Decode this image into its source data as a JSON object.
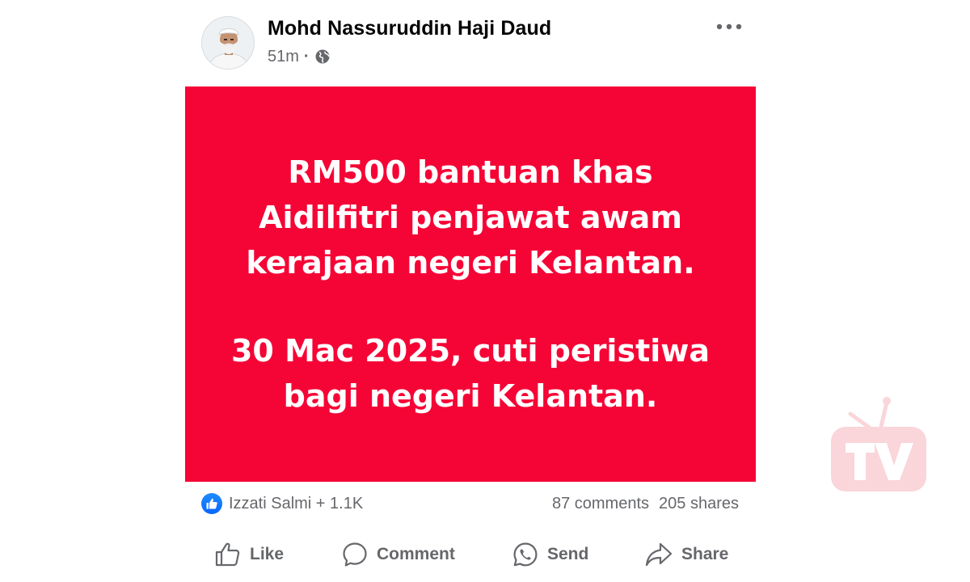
{
  "post": {
    "author": "Mohd Nassuruddin Haji Daud",
    "timestamp": "51m",
    "separator": "·",
    "privacy_icon": "globe-icon",
    "more_icon": "more-horizontal-icon",
    "image_text": {
      "line1": "RM500 bantuan khas",
      "line2": "Aidilfitri penjawat awam",
      "line3": "kerajaan negeri Kelantan.",
      "line4": "30 Mac 2025, cuti peristiwa",
      "line5": "bagi negeri Kelantan."
    },
    "image_bg_color": "#f50536"
  },
  "reactions": {
    "icon": "like-reaction-icon",
    "summary": "Izzati Salmi + 1.1K",
    "comments": "87 comments",
    "shares": "205 shares"
  },
  "actions": {
    "like": "Like",
    "comment": "Comment",
    "send": "Send",
    "share": "Share"
  },
  "colors": {
    "accent_blue": "#0866ff",
    "secondary_text": "#65676b",
    "primary_text": "#050505"
  },
  "watermark": {
    "icon": "tv-logo-watermark"
  }
}
